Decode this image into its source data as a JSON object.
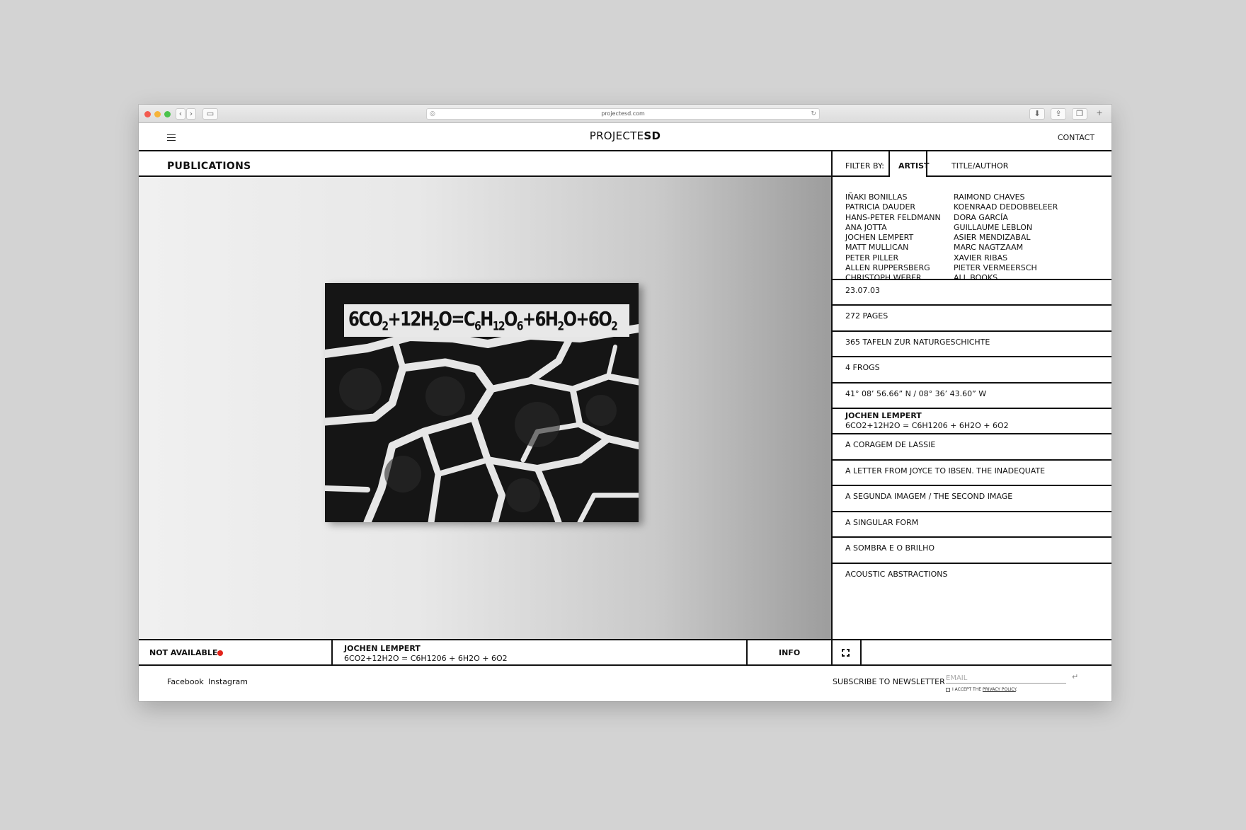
{
  "browser": {
    "url": "projectesd.com"
  },
  "header": {
    "logo_light": "PROJECTE",
    "logo_bold": "SD",
    "contact": "CONTACT"
  },
  "section": {
    "title": "PUBLICATIONS"
  },
  "filter": {
    "label": "FILTER BY:",
    "options": [
      "ARTIST",
      "TITLE/AUTHOR"
    ],
    "active": "ARTIST"
  },
  "artists": {
    "col1": [
      "IÑAKI BONILLAS",
      "PATRICIA DAUDER",
      "HANS-PETER FELDMANN",
      "ANA JOTTA",
      "JOCHEN LEMPERT",
      "MATT MULLICAN",
      "PETER PILLER",
      "ALLEN RUPPERSBERG",
      "CHRISTOPH WEBER"
    ],
    "col2": [
      "RAIMOND CHAVES",
      "KOENRAAD DEDOBBELEER",
      "DORA GARCÍA",
      "GUILLAUME LEBLON",
      "ASIER MENDIZABAL",
      "MARC NAGTZAAM",
      "XAVIER RIBAS",
      "PIETER VERMEERSCH",
      "ALL BOOKS"
    ]
  },
  "publications": [
    "23.07.03",
    "272 PAGES",
    "365 TAFELN ZUR NATURGESCHICHTE",
    "4 FROGS",
    "41° 08’ 56.66” N / 08° 36’ 43.60” W",
    "A CORAGEM DE LASSIE",
    "A LETTER FROM JOYCE TO IBSEN. THE INADEQUATE",
    "A SEGUNDA IMAGEM / THE SECOND IMAGE",
    "A SINGULAR FORM",
    "A SOMBRA E O BRILHO",
    "ACOUSTIC ABSTRACTIONS"
  ],
  "selected": {
    "artist": "JOCHEN LEMPERT",
    "title": "6CO2+12H2O = C6H1206 + 6H2O + 6O2",
    "cover_formula": "6CO2+12H2O=C6H12O6+6H2O+6O2",
    "availability": "NOT AVAILABLE",
    "availability_color": "#e2231a"
  },
  "bottom_bar": {
    "info": "INFO"
  },
  "footer": {
    "links": [
      "Facebook",
      "Instagram"
    ],
    "subscribe": "SUBSCRIBE TO NEWSLETTER",
    "email_placeholder": "EMAIL",
    "consent_prefix": "I ACCEPT THE ",
    "consent_link": "PRIVACY POLICY",
    "consent_suffix": "."
  },
  "icons": [
    "menu-icon",
    "expand-icon",
    "enter-icon",
    "back-icon",
    "forward-icon",
    "sidebar-icon",
    "download-icon",
    "share-icon",
    "tabs-icon",
    "reload-icon"
  ]
}
